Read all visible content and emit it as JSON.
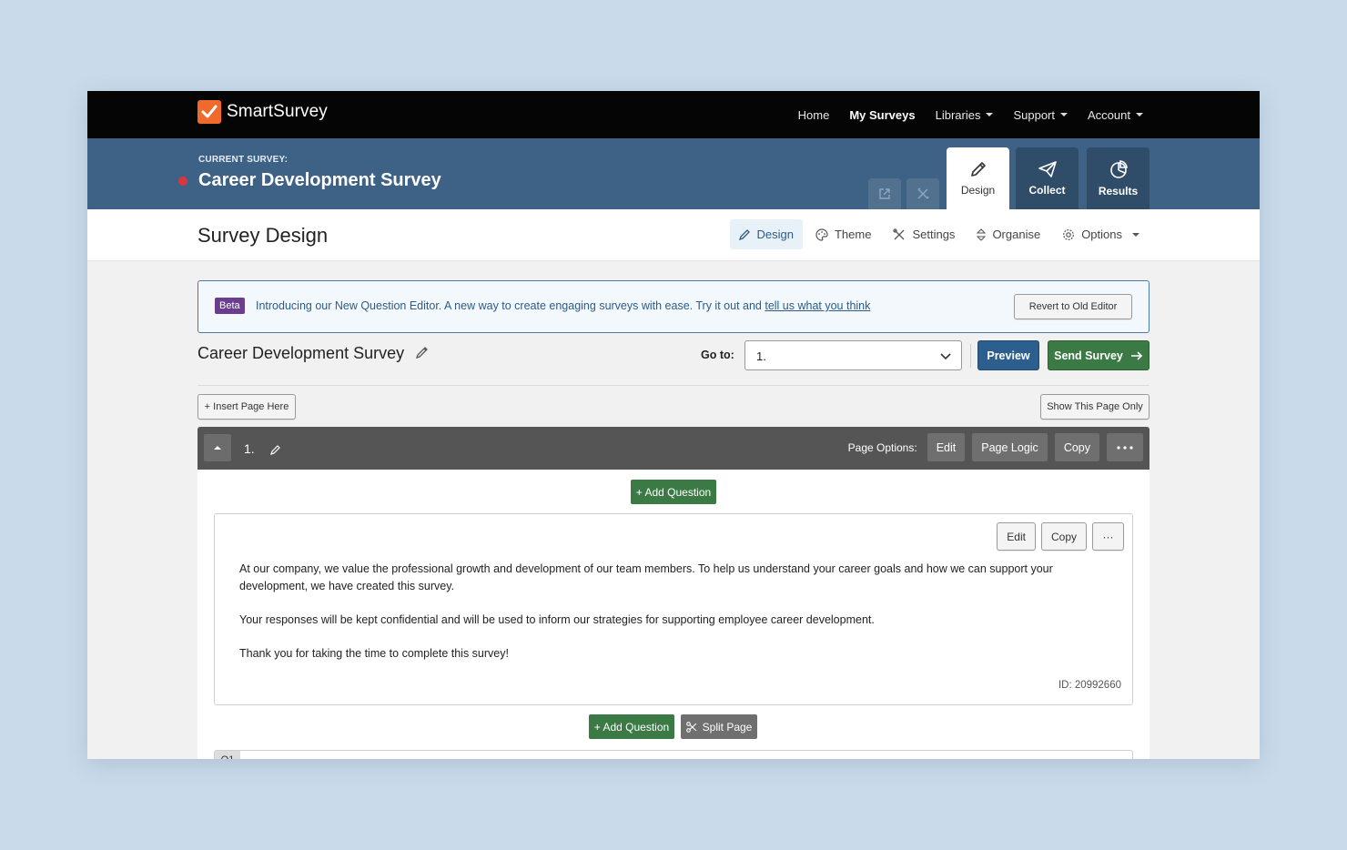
{
  "brand": {
    "name": "SmartSurvey",
    "accent": "#ef6a2b"
  },
  "topnav": {
    "items": [
      {
        "label": "Home",
        "dropdown": false,
        "active": false
      },
      {
        "label": "My Surveys",
        "dropdown": false,
        "active": true
      },
      {
        "label": "Libraries",
        "dropdown": true,
        "active": false
      },
      {
        "label": "Support",
        "dropdown": true,
        "active": false
      },
      {
        "label": "Account",
        "dropdown": true,
        "active": false
      }
    ]
  },
  "survey_header": {
    "label": "CURRENT SURVEY:",
    "title": "Career Development Survey",
    "status_color": "#d9363e",
    "tabs": [
      {
        "label": "Design",
        "icon": "pencil-icon",
        "active": true
      },
      {
        "label": "Collect",
        "icon": "paper-plane-icon",
        "active": false
      },
      {
        "label": "Results",
        "icon": "pie-chart-icon",
        "active": false
      }
    ]
  },
  "subheader": {
    "title": "Survey Design",
    "tabs": [
      {
        "label": "Design",
        "icon": "pencil-icon",
        "active": true
      },
      {
        "label": "Theme",
        "icon": "palette-icon",
        "active": false
      },
      {
        "label": "Settings",
        "icon": "tools-icon",
        "active": false
      },
      {
        "label": "Organise",
        "icon": "sort-icon",
        "active": false
      },
      {
        "label": "Options",
        "icon": "gear-icon",
        "active": false
      }
    ]
  },
  "beta_banner": {
    "badge": "Beta",
    "text": "Introducing our New Question Editor. A new way to create engaging surveys with ease. Try it out and ",
    "link": "tell us what you think",
    "revert_label": "Revert to Old Editor"
  },
  "survey_row": {
    "name": "Career Development Survey",
    "goto_label": "Go to:",
    "goto_value": "1.",
    "preview_label": "Preview",
    "send_label": "Send Survey"
  },
  "page_actions": {
    "insert_label": "+ Insert Page Here",
    "show_only_label": "Show This Page Only"
  },
  "page": {
    "number": "1.",
    "options_label": "Page Options:",
    "edit_label": "Edit",
    "logic_label": "Page Logic",
    "copy_label": "Copy",
    "add_question_label": "+ Add Question",
    "split_label": "Split Page"
  },
  "question": {
    "edit_label": "Edit",
    "copy_label": "Copy",
    "more_label": "···",
    "paragraphs": [
      "At our company, we value the professional growth and development of our team members. To help us understand your career goals and how we can support your development, we have created this survey.",
      "Your responses will be kept confidential and will be used to inform our strategies for supporting employee career development.",
      "Thank you for taking the time to complete this survey!"
    ],
    "id_label": "ID: 20992660"
  },
  "next_question": {
    "tag": "Q1"
  }
}
